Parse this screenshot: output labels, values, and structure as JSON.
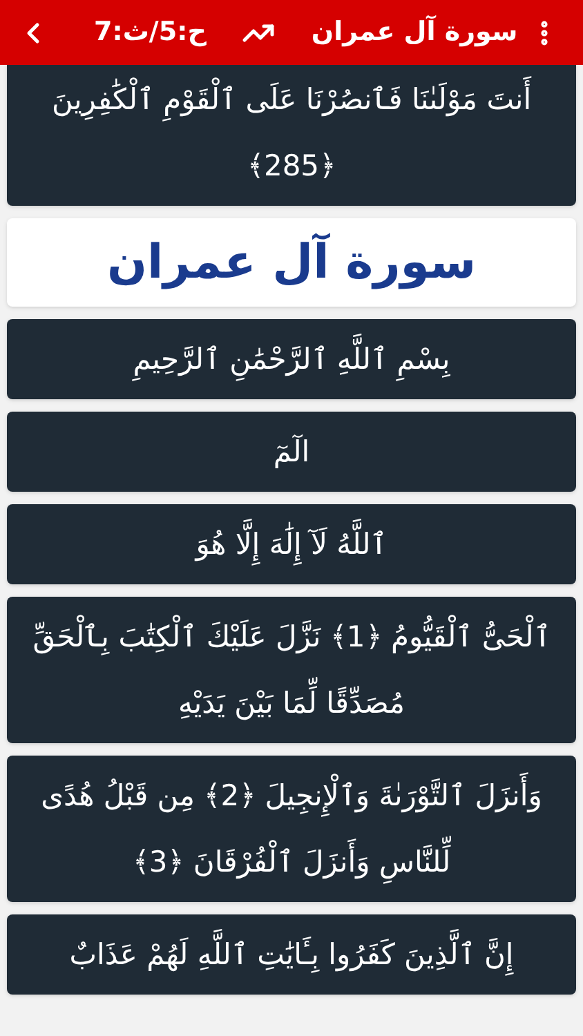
{
  "header": {
    "reference": "ح:5/ث:7",
    "title": "سورة آل عمران"
  },
  "items": [
    {
      "kind": "verse",
      "text": "أَنتَ مَوْلَىٰنَا فَٱنصُرْنَا عَلَى ٱلْقَوْمِ ٱلْكَٰفِرِينَ ﴿285﴾"
    },
    {
      "kind": "title",
      "text": "سورة آل عمران"
    },
    {
      "kind": "verse",
      "text": "بِسْمِ ٱللَّهِ ٱلرَّحْمَٰنِ ٱلرَّحِيمِ"
    },
    {
      "kind": "verse",
      "text": "الٓمٓ"
    },
    {
      "kind": "verse",
      "text": "ٱللَّهُ لَآ إِلَٰهَ إِلَّا هُوَ"
    },
    {
      "kind": "verse",
      "text": "ٱلْحَىُّ ٱلْقَيُّومُ ﴿1﴾ نَزَّلَ عَلَيْكَ ٱلْكِتَٰبَ بِٱلْحَقِّ مُصَدِّقًا لِّمَا بَيْنَ يَدَيْهِ"
    },
    {
      "kind": "verse",
      "text": "وَأَنزَلَ ٱلتَّوْرَىٰةَ وَٱلْإِنجِيلَ ﴿2﴾ مِن قَبْلُ هُدًى لِّلنَّاسِ وَأَنزَلَ ٱلْفُرْقَانَ ﴿3﴾"
    },
    {
      "kind": "verse",
      "text": "إِنَّ ٱلَّذِينَ كَفَرُوا بِـَٔايَٰتِ ٱللَّهِ لَهُمْ عَذَابٌ"
    }
  ]
}
